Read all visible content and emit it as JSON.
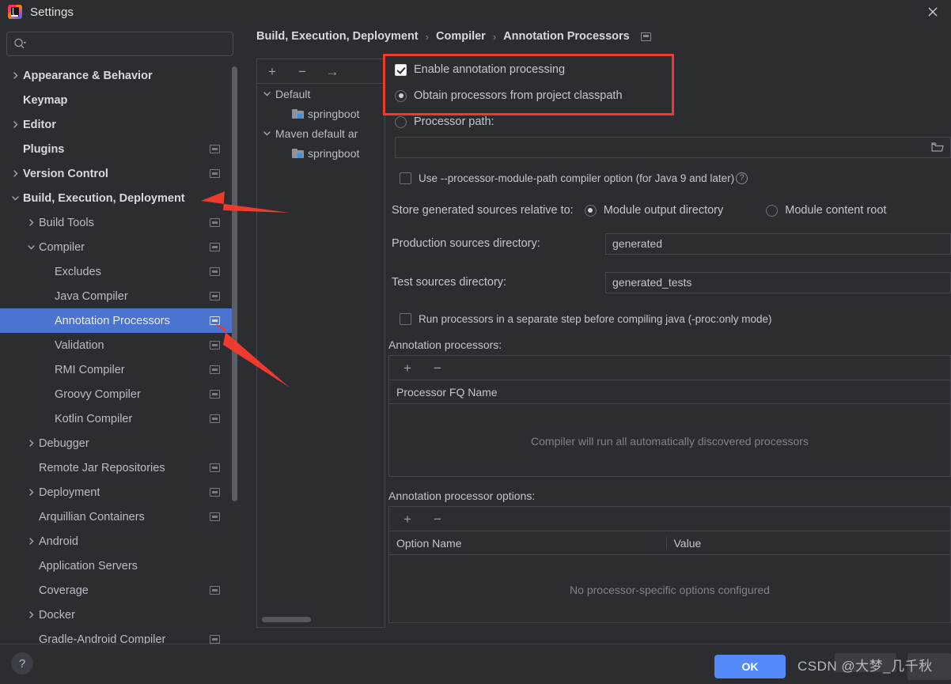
{
  "window": {
    "title": "Settings",
    "app_icon": "intellij-idea-logo",
    "close_icon": "close-icon"
  },
  "search": {
    "value": "",
    "placeholder": "",
    "icon": "search-icon"
  },
  "sidebar": {
    "items": [
      {
        "label": "Appearance & Behavior",
        "level": 0,
        "arrow": "chevron-right",
        "badge": false,
        "selected": false
      },
      {
        "label": "Keymap",
        "level": 0,
        "arrow": "none",
        "badge": false,
        "selected": false
      },
      {
        "label": "Editor",
        "level": 0,
        "arrow": "chevron-right",
        "badge": false,
        "selected": false
      },
      {
        "label": "Plugins",
        "level": 0,
        "arrow": "none",
        "badge": true,
        "selected": false
      },
      {
        "label": "Version Control",
        "level": 0,
        "arrow": "chevron-right",
        "badge": true,
        "selected": false
      },
      {
        "label": "Build, Execution, Deployment",
        "level": 0,
        "arrow": "chevron-down",
        "badge": false,
        "selected": false
      },
      {
        "label": "Build Tools",
        "level": 1,
        "arrow": "chevron-right",
        "badge": true,
        "selected": false
      },
      {
        "label": "Compiler",
        "level": 1,
        "arrow": "chevron-down",
        "badge": true,
        "selected": false
      },
      {
        "label": "Excludes",
        "level": 2,
        "arrow": "none",
        "badge": true,
        "selected": false
      },
      {
        "label": "Java Compiler",
        "level": 2,
        "arrow": "none",
        "badge": true,
        "selected": false
      },
      {
        "label": "Annotation Processors",
        "level": 2,
        "arrow": "none",
        "badge": true,
        "selected": true
      },
      {
        "label": "Validation",
        "level": 2,
        "arrow": "none",
        "badge": true,
        "selected": false
      },
      {
        "label": "RMI Compiler",
        "level": 2,
        "arrow": "none",
        "badge": true,
        "selected": false
      },
      {
        "label": "Groovy Compiler",
        "level": 2,
        "arrow": "none",
        "badge": true,
        "selected": false
      },
      {
        "label": "Kotlin Compiler",
        "level": 2,
        "arrow": "none",
        "badge": true,
        "selected": false
      },
      {
        "label": "Debugger",
        "level": 1,
        "arrow": "chevron-right",
        "badge": false,
        "selected": false
      },
      {
        "label": "Remote Jar Repositories",
        "level": 1,
        "arrow": "none",
        "badge": true,
        "selected": false
      },
      {
        "label": "Deployment",
        "level": 1,
        "arrow": "chevron-right",
        "badge": true,
        "selected": false
      },
      {
        "label": "Arquillian Containers",
        "level": 1,
        "arrow": "none",
        "badge": true,
        "selected": false
      },
      {
        "label": "Android",
        "level": 1,
        "arrow": "chevron-right",
        "badge": false,
        "selected": false
      },
      {
        "label": "Application Servers",
        "level": 1,
        "arrow": "none",
        "badge": false,
        "selected": false
      },
      {
        "label": "Coverage",
        "level": 1,
        "arrow": "none",
        "badge": true,
        "selected": false
      },
      {
        "label": "Docker",
        "level": 1,
        "arrow": "chevron-right",
        "badge": false,
        "selected": false
      },
      {
        "label": "Gradle-Android Compiler",
        "level": 1,
        "arrow": "none",
        "badge": true,
        "selected": false
      }
    ]
  },
  "breadcrumb": {
    "parts": [
      "Build, Execution, Deployment",
      "Compiler",
      "Annotation Processors"
    ],
    "separator": "›",
    "badge_icon": "project-scope-icon"
  },
  "module_panel": {
    "toolbar": {
      "add_label": "+",
      "remove_label": "−",
      "move_label": "→"
    },
    "rows": [
      {
        "label": "Default",
        "type": "group",
        "arrow": "chevron-down"
      },
      {
        "label": "springboot",
        "type": "module",
        "arrow": "none"
      },
      {
        "label": "Maven default ar",
        "type": "group",
        "arrow": "chevron-down"
      },
      {
        "label": "springboot",
        "type": "module",
        "arrow": "none"
      }
    ]
  },
  "settings": {
    "enable_annotation_processing": {
      "label": "Enable annotation processing",
      "checked": true
    },
    "processor_source": {
      "selected": "Obtain processors from project classpath",
      "options": [
        {
          "label": "Obtain processors from project classpath",
          "checked": true
        },
        {
          "label": "Processor path:",
          "checked": false
        }
      ]
    },
    "processor_path": {
      "value": "",
      "browse_icon": "folder-icon"
    },
    "use_processor_module_path": {
      "label": "Use --processor-module-path compiler option (for Java 9 and later)",
      "checked": false,
      "help_icon": "help-icon",
      "help_label": "?"
    },
    "store_generated_sources": {
      "label": "Store generated sources relative to:",
      "options": [
        {
          "label": "Module output directory",
          "checked": true
        },
        {
          "label": "Module content root",
          "checked": false
        }
      ]
    },
    "production_sources": {
      "label": "Production sources directory:",
      "value": "generated"
    },
    "test_sources": {
      "label": "Test sources directory:",
      "value": "generated_tests"
    },
    "run_processors_separate": {
      "label": "Run processors in a separate step before compiling java (-proc:only mode)",
      "checked": false
    },
    "annotation_processors": {
      "section_label": "Annotation processors:",
      "add_label": "+",
      "remove_label": "−",
      "columns": [
        "Processor FQ Name"
      ],
      "empty_text": "Compiler will run all automatically discovered processors",
      "rows": []
    },
    "annotation_processor_options": {
      "section_label": "Annotation processor options:",
      "add_label": "+",
      "remove_label": "−",
      "columns": [
        "Option Name",
        "Value"
      ],
      "empty_text": "No processor-specific options configured",
      "rows": []
    }
  },
  "footer": {
    "help_label": "?",
    "ok_label": "OK",
    "watermark": "CSDN @大梦_几千秋"
  },
  "colors": {
    "accent": "#4a74cf",
    "ok_button": "#548af7",
    "annotation_red": "#ef3b2d",
    "background": "#2b2d30",
    "folder_blue": "#3592f5"
  }
}
